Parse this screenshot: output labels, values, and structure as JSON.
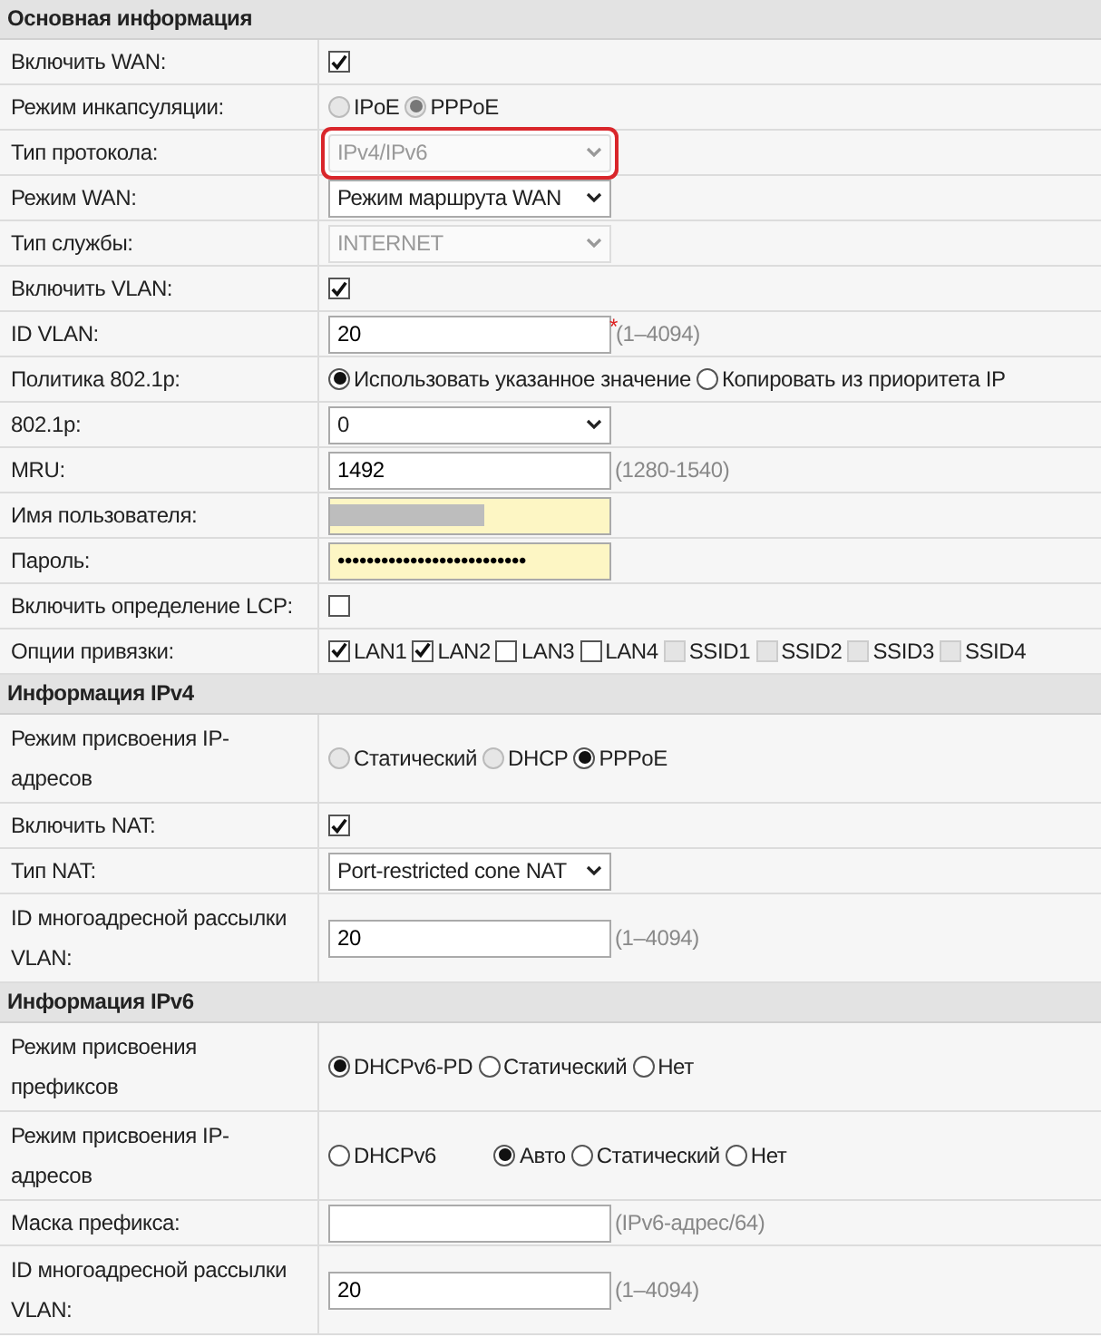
{
  "sections": [
    {
      "title": "Основная информация",
      "rows": [
        {
          "label": "Включить WAN:",
          "kind": "checkbox",
          "checked": true
        },
        {
          "label": "Режим инкапсуляции:",
          "kind": "radio",
          "options": [
            {
              "label": "IPoE",
              "selected": false,
              "disabled": true
            },
            {
              "label": "PPPoE",
              "selected": true,
              "disabled": true
            }
          ]
        },
        {
          "label": "Тип протокола:",
          "kind": "select",
          "value": "IPv4/IPv6",
          "disabled": true,
          "highlighted": true
        },
        {
          "label": "Режим WAN:",
          "kind": "select",
          "value": "Режим маршрута WAN",
          "disabled": false
        },
        {
          "label": "Тип службы:",
          "kind": "select",
          "value": "INTERNET",
          "disabled": true
        },
        {
          "label": "Включить VLAN:",
          "kind": "checkbox",
          "checked": true
        },
        {
          "label": "ID VLAN:",
          "kind": "text",
          "value": "20",
          "required_mark": "*",
          "hint": "(1–4094)"
        },
        {
          "label": "Политика 802.1p:",
          "kind": "radio",
          "options": [
            {
              "label": "Использовать указанное значение",
              "selected": true,
              "disabled": false
            },
            {
              "label": "Копировать из приоритета IP",
              "selected": false,
              "disabled": false
            }
          ]
        },
        {
          "label": "802.1p:",
          "kind": "select",
          "value": "0",
          "disabled": false
        },
        {
          "label": "MRU:",
          "kind": "text",
          "value": "1492",
          "hint": "(1280-1540)"
        },
        {
          "label": "Имя пользователя:",
          "kind": "redacted",
          "autofilled": true
        },
        {
          "label": "Пароль:",
          "kind": "password",
          "value": "••••••••••••••••••••••••••",
          "autofilled": true
        },
        {
          "label": "Включить определение LCP:",
          "kind": "checkbox",
          "checked": false
        },
        {
          "label": "Опции привязки:",
          "kind": "checkgroup",
          "options": [
            {
              "label": "LAN1",
              "checked": true,
              "disabled": false
            },
            {
              "label": "LAN2",
              "checked": true,
              "disabled": false
            },
            {
              "label": "LAN3",
              "checked": false,
              "disabled": false
            },
            {
              "label": "LAN4",
              "checked": false,
              "disabled": false
            },
            {
              "label": "SSID1",
              "checked": false,
              "disabled": true
            },
            {
              "label": "SSID2",
              "checked": false,
              "disabled": true
            },
            {
              "label": "SSID3",
              "checked": false,
              "disabled": true
            },
            {
              "label": "SSID4",
              "checked": false,
              "disabled": true
            }
          ]
        }
      ]
    },
    {
      "title": "Информация IPv4",
      "rows": [
        {
          "label": "Режим присвоения IP-адресов",
          "kind": "radio",
          "options": [
            {
              "label": "Статический",
              "selected": false,
              "disabled": true
            },
            {
              "label": "DHCP",
              "selected": false,
              "disabled": true
            },
            {
              "label": "PPPoE",
              "selected": true,
              "disabled": false
            }
          ]
        },
        {
          "label": "Включить NAT:",
          "kind": "checkbox",
          "checked": true
        },
        {
          "label": "Тип NAT:",
          "kind": "select",
          "value": "Port-restricted cone NAT",
          "disabled": false
        },
        {
          "label": "ID многоадресной рассылки VLAN:",
          "kind": "text",
          "value": "20",
          "hint": "(1–4094)"
        }
      ]
    },
    {
      "title": "Информация IPv6",
      "rows": [
        {
          "label": "Режим присвоения префиксов",
          "kind": "radio",
          "options": [
            {
              "label": "DHCPv6-PD",
              "selected": true,
              "disabled": false
            },
            {
              "label": "Статический",
              "selected": false,
              "disabled": false
            },
            {
              "label": "Нет",
              "selected": false,
              "disabled": false
            }
          ]
        },
        {
          "label": "Режим присвоения IP-адресов",
          "kind": "radio",
          "options": [
            {
              "label": "DHCPv6",
              "selected": false,
              "disabled": false
            },
            {
              "label": "Авто",
              "selected": true,
              "disabled": false
            },
            {
              "label": "Статический",
              "selected": false,
              "disabled": false
            },
            {
              "label": "Нет",
              "selected": false,
              "disabled": false
            }
          ]
        },
        {
          "label": "Маска префикса:",
          "kind": "text",
          "value": "",
          "hint": "(IPv6-адрес/64)"
        },
        {
          "label": "ID многоадресной рассылки VLAN:",
          "kind": "text",
          "value": "20",
          "hint": "(1–4094)"
        }
      ]
    }
  ]
}
